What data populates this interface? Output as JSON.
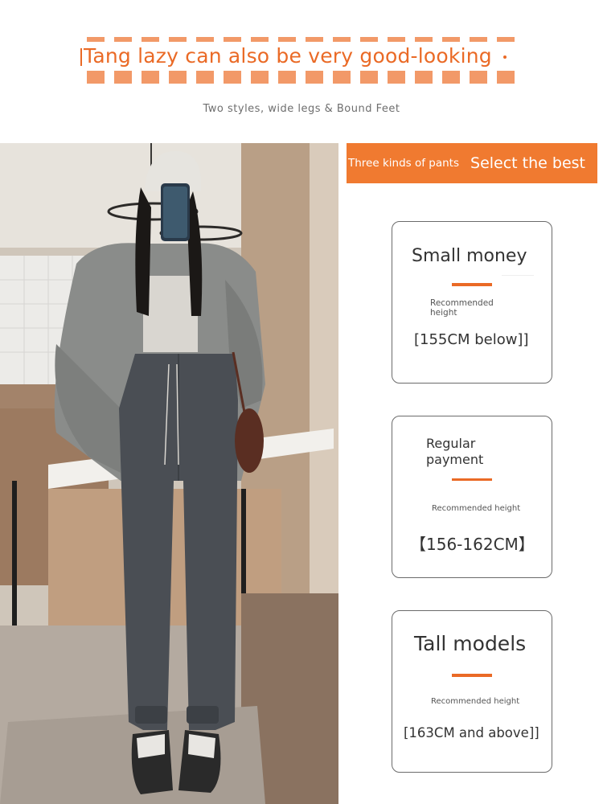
{
  "header": {
    "headline": "Tang lazy can also be very good-looking",
    "subtitle": "Two styles, wide legs & Bound Feet"
  },
  "banner": {
    "left_text": "Three kinds of pants",
    "right_text": "Select the best"
  },
  "cards": [
    {
      "title": "Small money",
      "recommended": "Recommended height",
      "height": "[155CM below]]"
    },
    {
      "title": "Regular payment",
      "recommended": "Recommended height",
      "height": "【156-162CM】"
    },
    {
      "title": "Tall models",
      "recommended": "Recommended height",
      "height": "[163CM and above]]"
    }
  ],
  "colors": {
    "accent": "#ea6a26",
    "banner": "#f07a30",
    "card_border": "#6b6b6b",
    "text": "#333333"
  }
}
